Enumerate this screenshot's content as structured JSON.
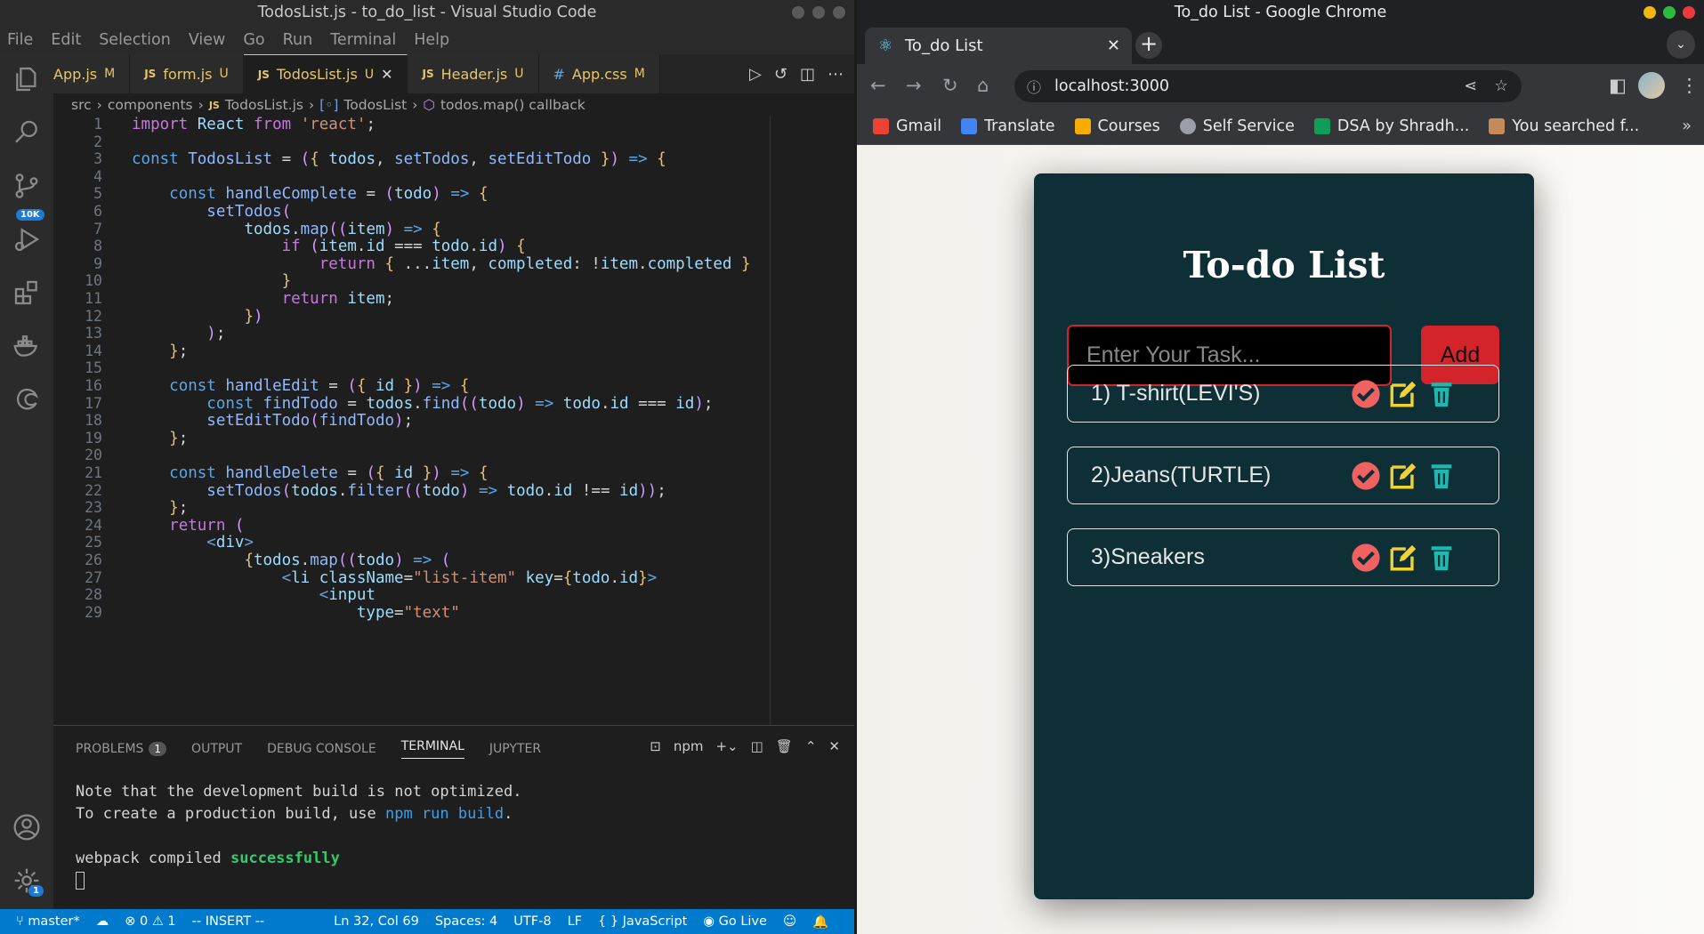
{
  "vscode": {
    "title": "TodosList.js - to_do_list - Visual Studio Code",
    "menu": [
      "File",
      "Edit",
      "Selection",
      "View",
      "Go",
      "Run",
      "Terminal",
      "Help"
    ],
    "tabs": [
      {
        "type": "JS",
        "name": "App.js",
        "status": "M"
      },
      {
        "type": "JS",
        "name": "form.js",
        "status": "U"
      },
      {
        "type": "JS",
        "name": "TodosList.js",
        "status": "U"
      },
      {
        "type": "JS",
        "name": "Header.js",
        "status": "U"
      },
      {
        "type": "#",
        "name": "App.css",
        "status": "M"
      }
    ],
    "source_control_badge": "10K",
    "settings_badge": "1",
    "breadcrumbs": [
      "src",
      "components",
      "TodosList.js",
      "TodosList",
      "todos.map() callback"
    ],
    "breadcrumb_js_tag": "JS",
    "code_lines": [
      "import React from 'react';",
      "",
      "const TodosList = ({ todos, setTodos, setEditTodo }) => {",
      "",
      "    const handleComplete = (todo) => {",
      "        setTodos(",
      "            todos.map((item) => {",
      "                if (item.id === todo.id) {",
      "                    return { ...item, completed: !item.completed }",
      "                }",
      "                return item;",
      "            })",
      "        );",
      "    };",
      "",
      "    const handleEdit = ({ id }) => {",
      "        const findTodo = todos.find((todo) => todo.id === id);",
      "        setEditTodo(findTodo);",
      "    };",
      "",
      "    const handleDelete = ({ id }) => {",
      "        setTodos(todos.filter((todo) => todo.id !== id));",
      "    };",
      "    return (",
      "        <div>",
      "            {todos.map((todo) => (",
      "                <li className=\"list-item\" key={todo.id}>",
      "                    <input",
      "                        type=\"text\""
    ],
    "panel": {
      "tabs": [
        "PROBLEMS",
        "OUTPUT",
        "DEBUG CONSOLE",
        "TERMINAL",
        "JUPYTER"
      ],
      "problems_count": "1",
      "terminal_name": "npm",
      "terminal_lines": [
        "Note that the development build is not optimized.",
        "To create a production build, use ",
        "npm run build",
        ".",
        "webpack compiled ",
        "successfully"
      ]
    },
    "statusbar": {
      "branch": "master*",
      "errors": "0",
      "warnings": "1",
      "mode": "-- INSERT --",
      "position": "Ln 32, Col 69",
      "spaces": "Spaces: 4",
      "encoding": "UTF-8",
      "eol": "LF",
      "language": "JavaScript",
      "golive": "Go Live"
    }
  },
  "chrome": {
    "title": "To_do List - Google Chrome",
    "tab_title": "To_do List",
    "url": "localhost:3000",
    "bookmarks": [
      "Gmail",
      "Translate",
      "Courses",
      "Self Service",
      "DSA by Shradh...",
      "You searched f..."
    ],
    "bookmark_colors": [
      "#ea4335",
      "#4285f4",
      "#f9ab00",
      "#9aa0a6",
      "#0f9d58",
      "#c58a5a"
    ]
  },
  "app": {
    "heading": "To-do List",
    "input_placeholder": "Enter Your Task...",
    "add_label": "Add",
    "accent": "#d2242a",
    "background": "#0f2f36",
    "items": [
      "1) T-shirt(LEVI'S)",
      "2)Jeans(TURTLE)",
      "3)Sneakers"
    ],
    "icon_colors": {
      "complete": "#f06262",
      "edit": "#f2d22e",
      "delete": "#1fb8b0"
    }
  }
}
